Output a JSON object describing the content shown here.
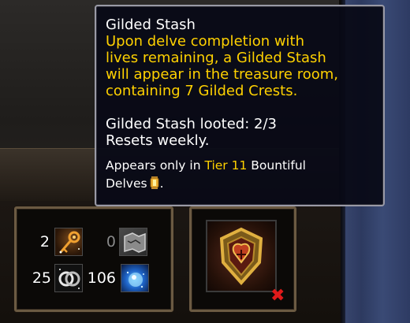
{
  "tooltip": {
    "title": "Gilded Stash",
    "desc_lines": [
      "Upon delve completion with",
      "lives remaining, a Gilded Stash",
      "will appear in the treasure room,",
      "containing 7 Gilded Crests."
    ],
    "looted": "Gilded Stash looted: 2/3",
    "resets": "Resets weekly.",
    "appears_prefix": "Appears only in ",
    "appears_tier": "Tier 11",
    "appears_suffix1": " Bountiful",
    "appears_line2": "Delves",
    "appears_end": ".",
    "icon": "lantern-icon"
  },
  "currencies": [
    {
      "value": "2",
      "icon": "key-icon",
      "dim": false
    },
    {
      "value": "0",
      "icon": "map-icon",
      "dim": true
    },
    {
      "value": "25",
      "icon": "rings-icon",
      "dim": false
    },
    {
      "value": "106",
      "icon": "orb-icon",
      "dim": false
    }
  ],
  "stash": {
    "icon": "gilded-stash-icon",
    "status_icon": "red-x-icon"
  },
  "colors": {
    "tooltip_gold": "#ffd100",
    "tooltip_border": "#9a9aa6",
    "box_border": "#6b5a42",
    "x_red": "#e01a1a"
  }
}
